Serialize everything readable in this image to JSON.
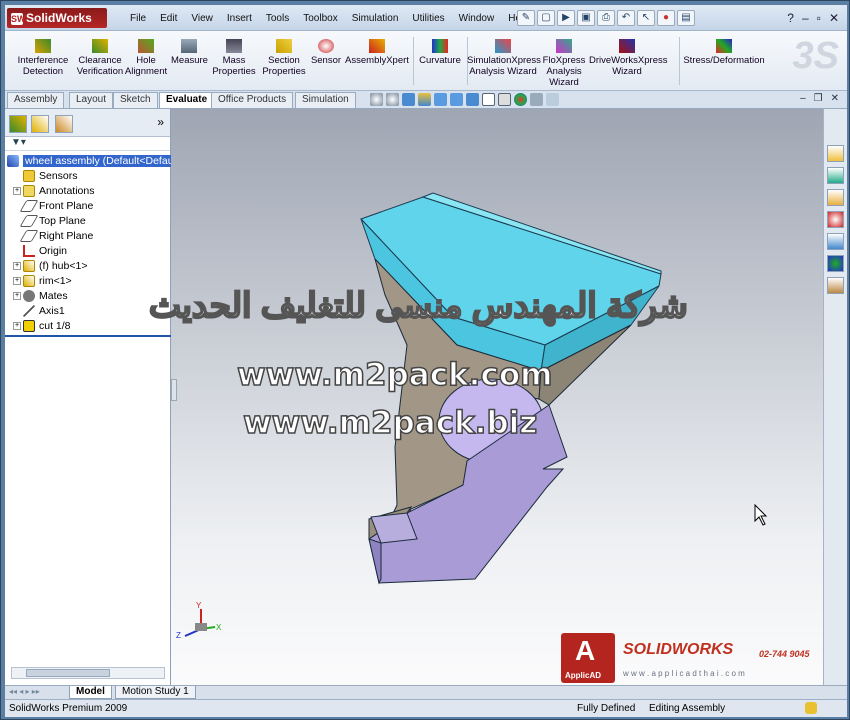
{
  "app": {
    "logo": "SolidWorks"
  },
  "menu": [
    "File",
    "Edit",
    "View",
    "Insert",
    "Tools",
    "Toolbox",
    "Simulation",
    "Utilities",
    "Window",
    "Help"
  ],
  "tools": [
    {
      "l1": "Interference",
      "l2": "Detection"
    },
    {
      "l1": "Clearance",
      "l2": "Verification"
    },
    {
      "l1": "Hole",
      "l2": "Alignment"
    },
    {
      "l1": "Measure",
      "l2": ""
    },
    {
      "l1": "Mass",
      "l2": "Properties"
    },
    {
      "l1": "Section",
      "l2": "Properties"
    },
    {
      "l1": "Sensor",
      "l2": ""
    },
    {
      "l1": "AssemblyXpert",
      "l2": ""
    },
    {
      "l1": "Curvature",
      "l2": ""
    },
    {
      "l1": "SimulationXpress",
      "l2": "Analysis Wizard"
    },
    {
      "l1": "FloXpress",
      "l2": "Analysis",
      "l3": "Wizard"
    },
    {
      "l1": "DriveWorksXpress",
      "l2": "Wizard"
    },
    {
      "l1": "Stress/Deformation",
      "l2": ""
    }
  ],
  "tabs": [
    "Assembly",
    "Layout",
    "Sketch",
    "Evaluate",
    "Office Products",
    "Simulation"
  ],
  "tree": {
    "root": "wheel assembly  (Default<Defau",
    "items": [
      "Sensors",
      "Annotations",
      "Front Plane",
      "Top Plane",
      "Right Plane",
      "Origin",
      "(f) hub<1>",
      "rim<1>",
      "Mates",
      "Axis1",
      "cut 1/8"
    ]
  },
  "watermark": {
    "arabic": "شركة المهندس منسى للتغليف الحديث",
    "url1": "www.m2pack.com",
    "url2": "www.m2pack.biz"
  },
  "brand": {
    "solidworks": "SOLIDWORKS",
    "phone": "02-744 9045",
    "site": "w w w . a p p l i c a d t h a i . c o m",
    "applicad": "ApplicAD"
  },
  "triad": {
    "x": "X",
    "y": "Y",
    "z": "Z"
  },
  "bottom_tabs": [
    "Model",
    "Motion Study 1"
  ],
  "status": {
    "product": "SolidWorks Premium 2009",
    "state": "Fully Defined",
    "mode": "Editing Assembly"
  }
}
